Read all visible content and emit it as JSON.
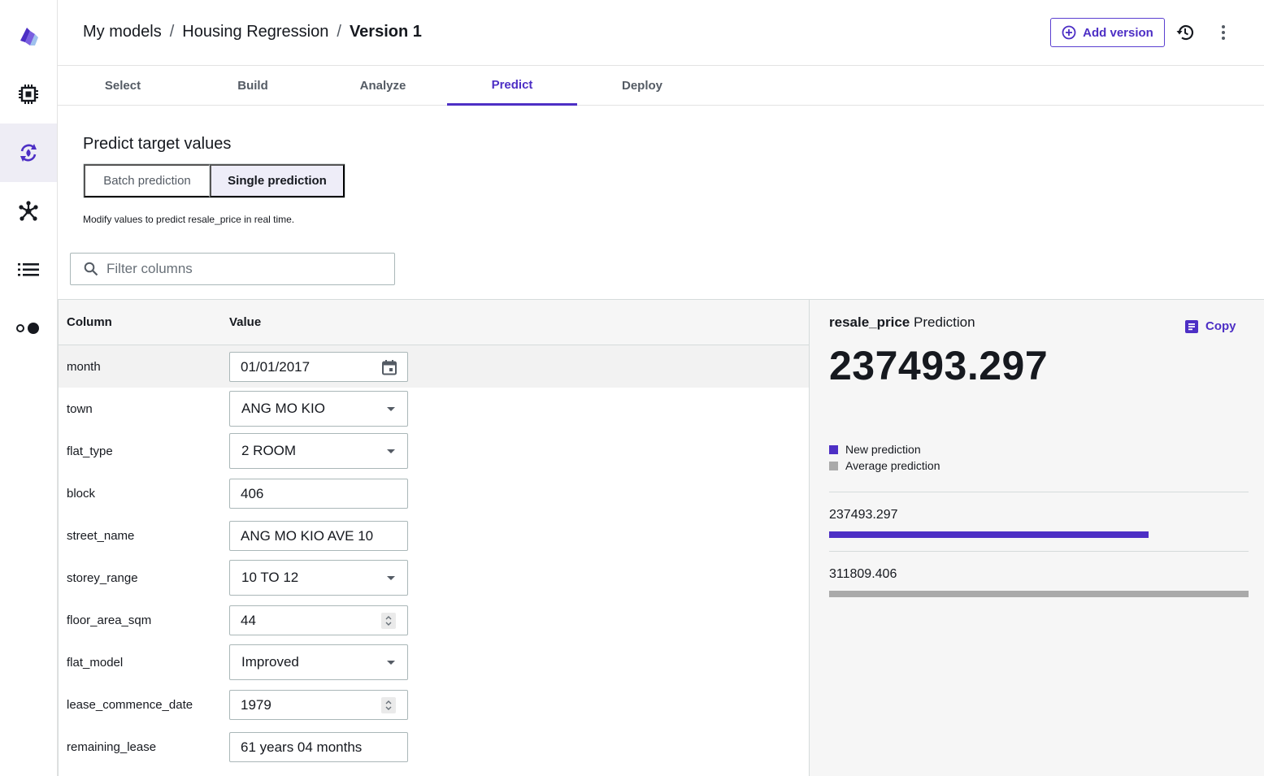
{
  "colors": {
    "accent": "#4d2fc5",
    "new_prediction": "#4d2fc5",
    "average_prediction": "#aaaaaa",
    "rail_active": "#eeedf5"
  },
  "rail": {
    "items": [
      {
        "icon": "app-logo-icon"
      },
      {
        "icon": "chip-icon"
      },
      {
        "icon": "model-cycle-icon",
        "active": true
      },
      {
        "icon": "hub-icon"
      },
      {
        "icon": "list-icon"
      },
      {
        "icon": "toggle-dots-icon"
      }
    ]
  },
  "header": {
    "breadcrumb": [
      "My models",
      "Housing Regression",
      "Version 1"
    ],
    "separator": "/",
    "add_version_label": "Add version"
  },
  "tabs": [
    {
      "label": "Select"
    },
    {
      "label": "Build"
    },
    {
      "label": "Analyze"
    },
    {
      "label": "Predict",
      "active": true
    },
    {
      "label": "Deploy"
    }
  ],
  "main": {
    "title": "Predict target values",
    "mode": {
      "batch_label": "Batch prediction",
      "single_label": "Single prediction",
      "selected": "Single prediction"
    },
    "hint": "Modify values to predict resale_price in real time.",
    "filter_placeholder": "Filter columns"
  },
  "table": {
    "headers": {
      "column": "Column",
      "value": "Value"
    },
    "rows": [
      {
        "column": "month",
        "value": "01/01/2017",
        "control": "date"
      },
      {
        "column": "town",
        "value": "ANG MO KIO",
        "control": "select"
      },
      {
        "column": "flat_type",
        "value": "2 ROOM",
        "control": "select"
      },
      {
        "column": "block",
        "value": "406",
        "control": "text"
      },
      {
        "column": "street_name",
        "value": "ANG MO KIO AVE 10",
        "control": "text"
      },
      {
        "column": "storey_range",
        "value": "10 TO 12",
        "control": "select"
      },
      {
        "column": "floor_area_sqm",
        "value": "44",
        "control": "number"
      },
      {
        "column": "flat_model",
        "value": "Improved",
        "control": "select"
      },
      {
        "column": "lease_commence_date",
        "value": "1979",
        "control": "number"
      },
      {
        "column": "remaining_lease",
        "value": "61 years 04 months",
        "control": "text"
      }
    ]
  },
  "prediction": {
    "target": "resale_price",
    "suffix": "Prediction",
    "copy_label": "Copy",
    "value": "237493.297",
    "legend": {
      "new": "New prediction",
      "average": "Average prediction"
    },
    "bars": [
      {
        "label": "237493.297",
        "value": 237493.297,
        "kind": "new"
      },
      {
        "label": "311809.406",
        "value": 311809.406,
        "kind": "average"
      }
    ]
  }
}
